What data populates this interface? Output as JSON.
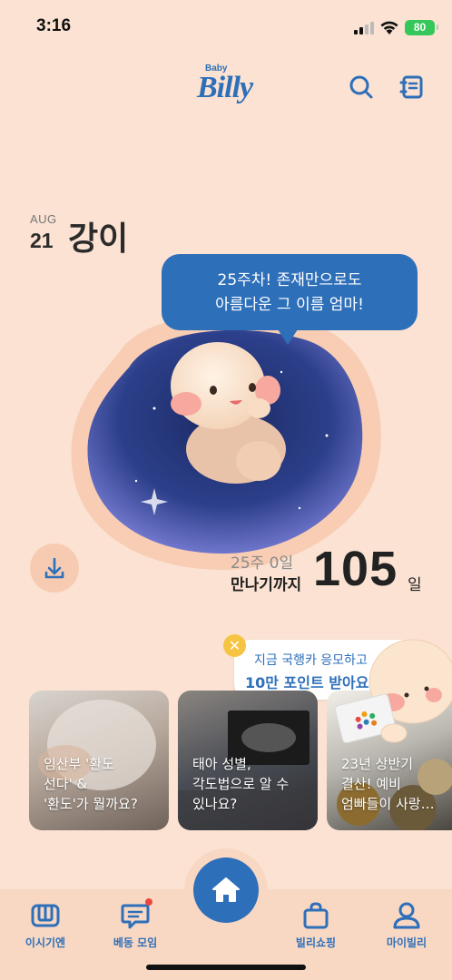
{
  "status_bar": {
    "time": "3:16",
    "battery": "80"
  },
  "header": {
    "logo_small": "Baby",
    "logo": "Billy",
    "search_icon": "search-icon",
    "diary_icon": "diary-icon"
  },
  "baby": {
    "date_month": "AUG",
    "date_day": "21",
    "name": "강이"
  },
  "bubble": {
    "line1": "25주차! 존재만으로도",
    "line2": "아름다운 그 이름 엄마!"
  },
  "countdown": {
    "week": "25주 0일",
    "until_label": "만나기까지",
    "days": "105",
    "unit": "일"
  },
  "promo": {
    "line1": "지금 국행카 응모하고",
    "line2": "10만 포인트 받아요!"
  },
  "cards": [
    {
      "lines": [
        "임산부 '환도",
        "선다' &",
        "'환도'가 뭘까요?"
      ]
    },
    {
      "lines": [
        "태아 성별,",
        "각도법으로 알 수",
        "있나요?"
      ]
    },
    {
      "lines": [
        "23년 상반기",
        "결산! 예비",
        "엄빠들이 사랑…"
      ]
    }
  ],
  "bottom_nav": {
    "items": [
      {
        "label": "이시기엔"
      },
      {
        "label": "베동 모임"
      },
      {
        "label": "빌리쇼핑"
      },
      {
        "label": "마이빌리"
      }
    ]
  },
  "colors": {
    "background": "#fbe2d2",
    "brand_blue": "#2e6fb9",
    "promo_close": "#f6c443",
    "notification_dot": "#e8483f"
  }
}
